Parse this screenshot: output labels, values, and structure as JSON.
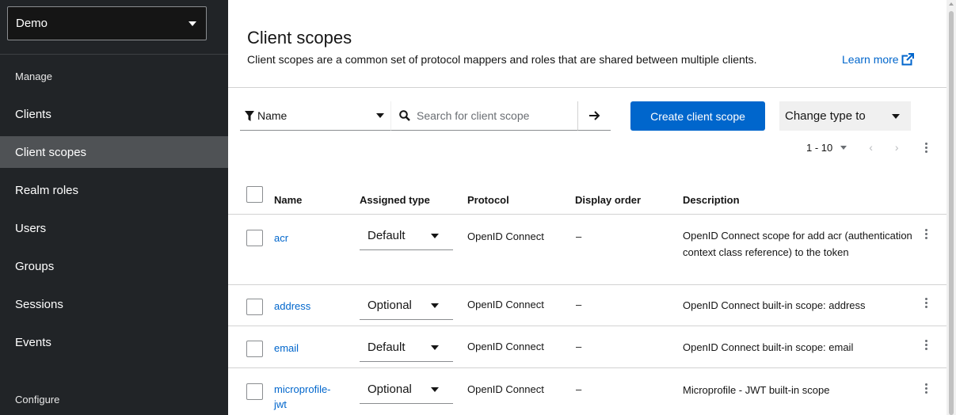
{
  "sidebar": {
    "realm": "Demo",
    "manage_label": "Manage",
    "items": [
      {
        "label": "Clients"
      },
      {
        "label": "Client scopes"
      },
      {
        "label": "Realm roles"
      },
      {
        "label": "Users"
      },
      {
        "label": "Groups"
      },
      {
        "label": "Sessions"
      },
      {
        "label": "Events"
      }
    ],
    "active_item": "Client scopes",
    "configure_label": "Configure"
  },
  "header": {
    "title": "Client scopes",
    "subtitle": "Client scopes are a common set of protocol mappers and roles that are shared between multiple clients.",
    "learn_more": "Learn more"
  },
  "toolbar": {
    "filter_label": "Name",
    "search_placeholder": "Search for client scope",
    "create_label": "Create client scope",
    "change_type_label": "Change type to",
    "pagination": "1 - 10"
  },
  "table": {
    "columns": [
      "Name",
      "Assigned type",
      "Protocol",
      "Display order",
      "Description"
    ],
    "rows": [
      {
        "name": "acr",
        "type": "Default",
        "protocol": "OpenID Connect",
        "order": "–",
        "description": "OpenID Connect scope for add acr (authentication context class reference) to the token"
      },
      {
        "name": "address",
        "type": "Optional",
        "protocol": "OpenID Connect",
        "order": "–",
        "description": "OpenID Connect built-in scope: address"
      },
      {
        "name": "email",
        "type": "Default",
        "protocol": "OpenID Connect",
        "order": "–",
        "description": "OpenID Connect built-in scope: email"
      },
      {
        "name": "microprofile-jwt",
        "type": "Optional",
        "protocol": "OpenID Connect",
        "order": "–",
        "description": "Microprofile - JWT built-in scope"
      }
    ]
  },
  "colors": {
    "sidebar_bg": "#212427",
    "sidebar_active": "#4f5255",
    "primary": "#0066cc",
    "link": "#0066cc"
  }
}
